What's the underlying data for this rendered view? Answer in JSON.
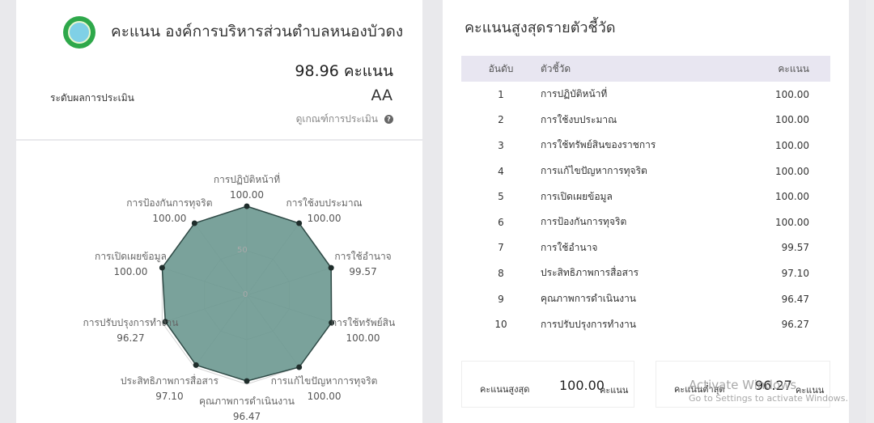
{
  "header": {
    "org_title": "คะแนน องค์การบริหารส่วนตำบลหนองบัวดง",
    "total_score": "98.96 คะแนน",
    "level_label": "ระดับผลการประเมิน",
    "level_value": "AA",
    "criteria_link": "ดูเกณฑ์การประเมิน",
    "logo_icon": "organization-seal-icon",
    "help_icon": "question-circle-icon"
  },
  "chart_data": {
    "type": "radar",
    "categories": [
      "การปฏิบัติหน้าที่",
      "การใช้งบประมาณ",
      "การใช้อำนาจ",
      "การใช้ทรัพย์สิน",
      "การแก้ไขปัญหาการทุจริต",
      "คุณภาพการดำเนินงาน",
      "ประสิทธิภาพการสื่อสาร",
      "การปรับปรุงการทำงาน",
      "การเปิดเผยข้อมูล",
      "การป้องกันการทุจริต"
    ],
    "values": [
      100.0,
      100.0,
      99.57,
      100.0,
      100.0,
      96.47,
      97.1,
      96.27,
      100.0,
      100.0
    ],
    "value_labels": [
      "100.00",
      "100.00",
      "99.57",
      "100.00",
      "100.00",
      "96.47",
      "97.10",
      "96.27",
      "100.00",
      "100.00"
    ],
    "axis_ticks": [
      "0",
      "50"
    ],
    "rlim": [
      0,
      100
    ],
    "fill_color": "#6b9890",
    "stroke_color": "#2f4a46",
    "point_color": "#1f2d2b"
  },
  "ranking": {
    "title": "คะแนนสูงสุดรายตัวชี้วัด",
    "columns": [
      "อันดับ",
      "ตัวชี้วัด",
      "คะแนน"
    ],
    "rows": [
      {
        "rank": "1",
        "indicator": "การปฏิบัติหน้าที่",
        "score": "100.00"
      },
      {
        "rank": "2",
        "indicator": "การใช้งบประมาณ",
        "score": "100.00"
      },
      {
        "rank": "3",
        "indicator": "การใช้ทรัพย์สินของราชการ",
        "score": "100.00"
      },
      {
        "rank": "4",
        "indicator": "การแก้ไขปัญหาการทุจริต",
        "score": "100.00"
      },
      {
        "rank": "5",
        "indicator": "การเปิดเผยข้อมูล",
        "score": "100.00"
      },
      {
        "rank": "6",
        "indicator": "การป้องกันการทุจริต",
        "score": "100.00"
      },
      {
        "rank": "7",
        "indicator": "การใช้อำนาจ",
        "score": "99.57"
      },
      {
        "rank": "8",
        "indicator": "ประสิทธิภาพการสื่อสาร",
        "score": "97.10"
      },
      {
        "rank": "9",
        "indicator": "คุณภาพการดำเนินงาน",
        "score": "96.47"
      },
      {
        "rank": "10",
        "indicator": "การปรับปรุงการทำงาน",
        "score": "96.27"
      }
    ]
  },
  "summary": {
    "max_label": "คะแนนสูงสุด",
    "max_value": "100.00",
    "min_label": "คะแนนต่ำสุด",
    "min_value": "96.27",
    "unit": "คะแนน"
  },
  "watermark": {
    "line1": "Activate Windows",
    "line2": "Go to Settings to activate Windows."
  }
}
